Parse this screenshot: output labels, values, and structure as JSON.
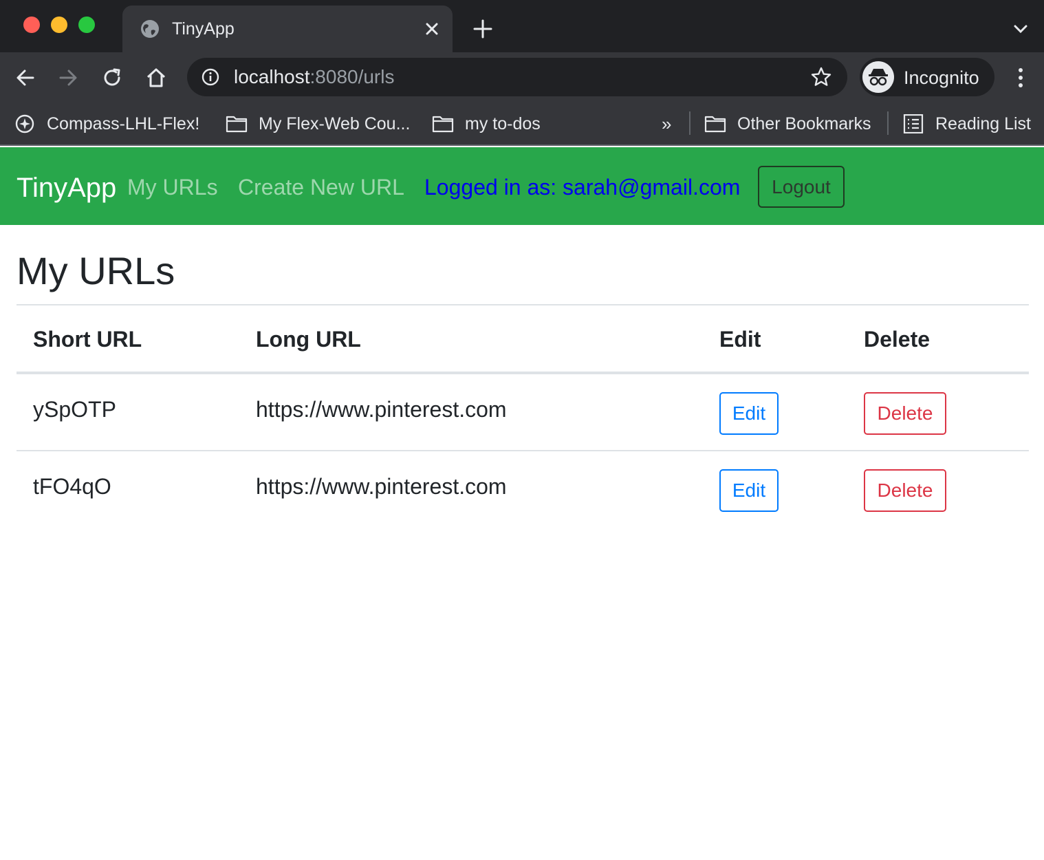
{
  "browser": {
    "tab_title": "TinyApp",
    "url_host": "localhost",
    "url_rest": ":8080/urls",
    "profile_label": "Incognito",
    "bookmarks": [
      {
        "label": "Compass-LHL-Flex!",
        "icon": "compass-icon"
      },
      {
        "label": "My Flex-Web Cou...",
        "icon": "folder-icon"
      },
      {
        "label": "my to-dos",
        "icon": "folder-icon"
      }
    ],
    "overflow_label": "»",
    "other_bookmarks": "Other Bookmarks",
    "reading_list": "Reading List"
  },
  "navbar": {
    "brand": "TinyApp",
    "my_urls": "My URLs",
    "create_new": "Create New URL",
    "logged_in": "Logged in as: sarah@gmail.com",
    "logout": "Logout",
    "bg_color": "#28a74b"
  },
  "main": {
    "title": "My URLs",
    "columns": [
      "Short URL",
      "Long URL",
      "Edit",
      "Delete"
    ],
    "rows": [
      {
        "short": "ySpOTP",
        "long": "https://www.pinterest.com",
        "edit": "Edit",
        "delete": "Delete"
      },
      {
        "short": "tFO4qO",
        "long": "https://www.pinterest.com",
        "edit": "Edit",
        "delete": "Delete"
      }
    ]
  }
}
